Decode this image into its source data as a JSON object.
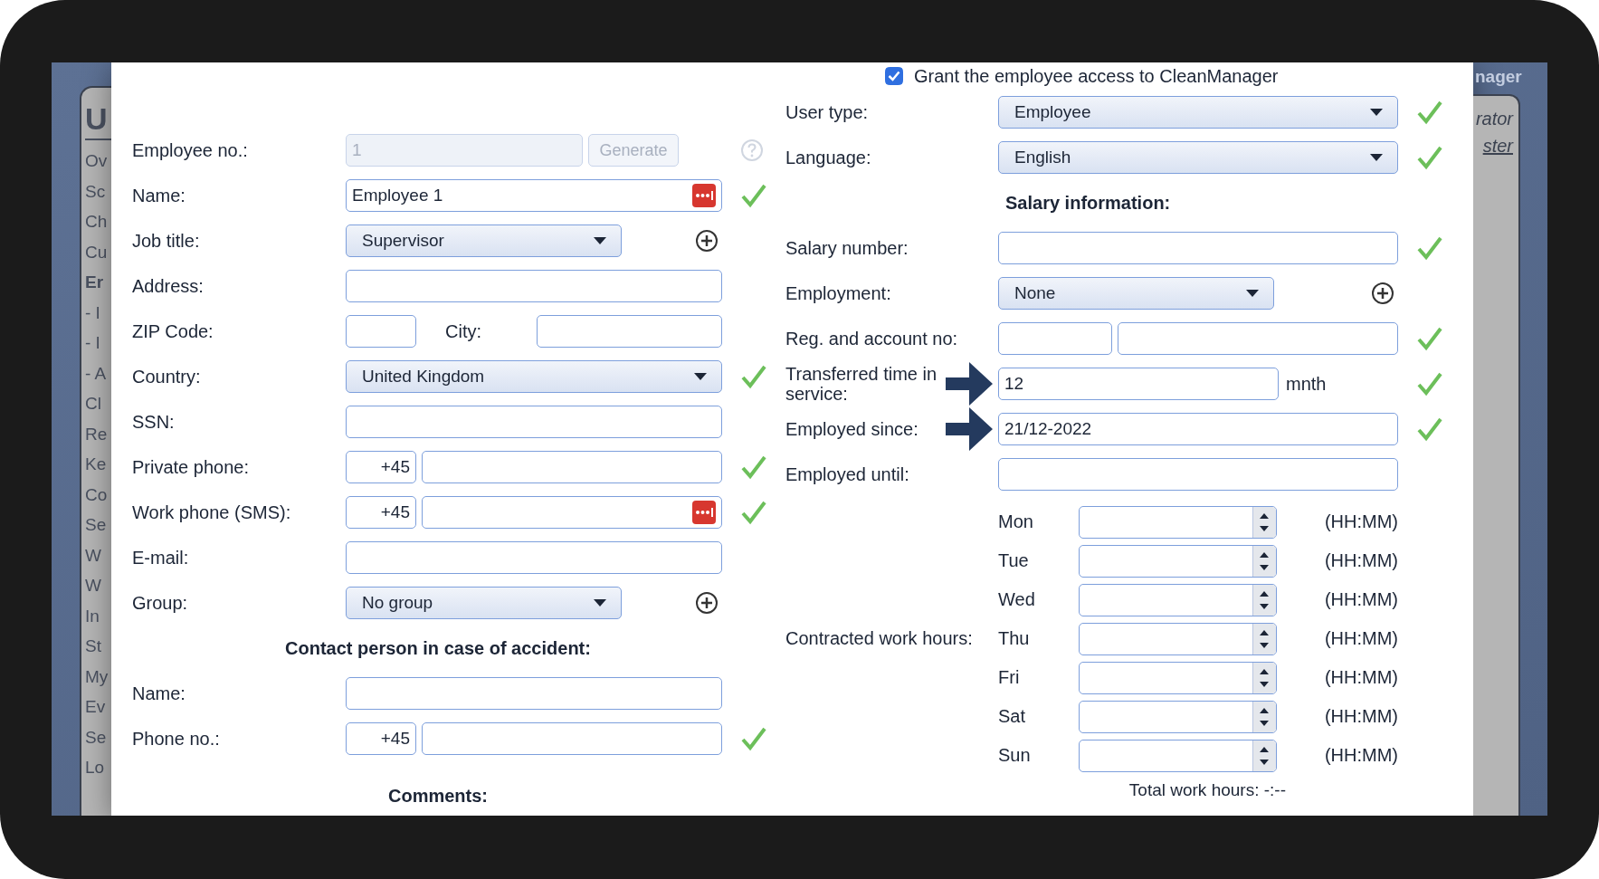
{
  "background_app": {
    "sidebar": {
      "heading": "U",
      "items": [
        {
          "label": "Ov",
          "selected": false
        },
        {
          "label": "Sc",
          "selected": false
        },
        {
          "label": "Ch",
          "selected": false
        },
        {
          "label": "Cu",
          "selected": false
        },
        {
          "label": "Er",
          "selected": true,
          "children": [
            {
              "label": "- I",
              "selected": false
            },
            {
              "label": "- I",
              "selected": false
            },
            {
              "label": "- A",
              "selected": false
            }
          ]
        },
        {
          "label": "Cl",
          "selected": false
        },
        {
          "label": "Re",
          "selected": false
        },
        {
          "label": "Ke",
          "selected": false
        },
        {
          "label": "Co",
          "selected": false
        },
        {
          "label": "Se",
          "selected": false
        },
        {
          "label": "W",
          "selected": false
        },
        {
          "label": "W",
          "selected": false
        },
        {
          "label": "In",
          "selected": false
        },
        {
          "label": "St",
          "selected": false
        },
        {
          "label": "My",
          "selected": false
        },
        {
          "label": "Ev",
          "selected": false
        },
        {
          "label": "Se",
          "selected": false
        },
        {
          "label": "Lo",
          "selected": false
        }
      ]
    },
    "header_title": "nager",
    "links": [
      "rator",
      "ster"
    ]
  },
  "access": {
    "checked": true,
    "label": "Grant the employee access to CleanManager"
  },
  "left_fields": [
    {
      "kind": "generate",
      "label": "Employee no.:",
      "value": "1",
      "button": "Generate",
      "disabled": true,
      "valid": false
    },
    {
      "kind": "text",
      "label": "Name:",
      "value": "Employee 1",
      "dots": true,
      "valid": true
    },
    {
      "kind": "select",
      "label": "Job title:",
      "value": "Supervisor",
      "add": true,
      "valid": false
    },
    {
      "kind": "text",
      "label": "Address:",
      "valid": false
    },
    {
      "kind": "zip_city",
      "label": "ZIP Code:",
      "city_label": "City:",
      "valid": false
    },
    {
      "kind": "select",
      "label": "Country:",
      "value": "United Kingdom",
      "valid": true
    },
    {
      "kind": "text",
      "label": "SSN:",
      "valid": false
    },
    {
      "kind": "phone",
      "label": "Private phone:",
      "prefix": "+45",
      "valid": true
    },
    {
      "kind": "phone",
      "label": "Work phone (SMS):",
      "prefix": "+45",
      "dots": true,
      "valid": true
    },
    {
      "kind": "text",
      "label": "E-mail:",
      "valid": false
    },
    {
      "kind": "select",
      "label": "Group:",
      "value": "No group",
      "add": true,
      "valid": false
    }
  ],
  "contact_heading": "Contact person in case of accident:",
  "contact_fields": [
    {
      "kind": "text",
      "label": "Name:",
      "valid": false
    },
    {
      "kind": "phone",
      "label": "Phone no.:",
      "prefix": "+45",
      "valid": true
    }
  ],
  "comments_label": "Comments:",
  "right_fields": [
    {
      "kind": "select",
      "label": "User type:",
      "value": "Employee",
      "valid": true
    },
    {
      "kind": "select",
      "label": "Language:",
      "value": "English",
      "valid": true
    },
    {
      "kind": "heading",
      "label": "Salary information:"
    },
    {
      "kind": "text",
      "label": "Salary number:",
      "valid": true
    },
    {
      "kind": "select",
      "label": "Employment:",
      "value": "None",
      "add": true,
      "valid": false
    },
    {
      "kind": "pair",
      "label": "Reg. and account no:",
      "valid": true
    },
    {
      "kind": "unit",
      "label": "Transferred time in service:",
      "value": "12",
      "unit": "mnth",
      "arrow": true,
      "valid": true
    },
    {
      "kind": "text",
      "label": "Employed since:",
      "value": "21/12-2022",
      "arrow": true,
      "valid": true
    },
    {
      "kind": "text",
      "label": "Employed until:",
      "valid": false
    }
  ],
  "work_hours": {
    "label": "Contracted work hours:",
    "days": [
      {
        "day": "Mon",
        "hint": "(HH:MM)"
      },
      {
        "day": "Tue",
        "hint": "(HH:MM)"
      },
      {
        "day": "Wed",
        "hint": "(HH:MM)"
      },
      {
        "day": "Thu",
        "hint": "(HH:MM)"
      },
      {
        "day": "Fri",
        "hint": "(HH:MM)"
      },
      {
        "day": "Sat",
        "hint": "(HH:MM)"
      },
      {
        "day": "Sun",
        "hint": "(HH:MM)"
      }
    ],
    "total": "Total work hours: -:--"
  }
}
